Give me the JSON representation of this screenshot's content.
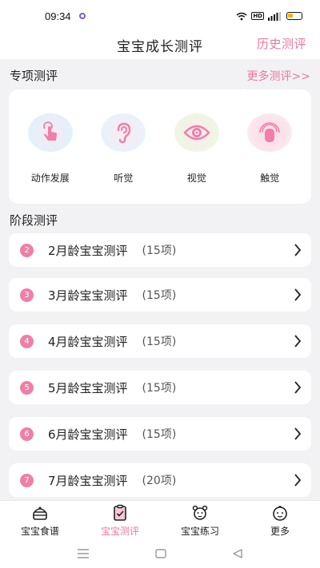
{
  "status": {
    "time": "09:34",
    "hd": "HD"
  },
  "header": {
    "title": "宝宝成长测评",
    "history": "历史测评"
  },
  "special": {
    "title": "专项测评",
    "more": "更多测评>>",
    "items": [
      {
        "label": "动作发展",
        "icon": "hand-tap-icon",
        "color": "#ee7fa8",
        "bubble": "#e2f2fa"
      },
      {
        "label": "听觉",
        "icon": "ear-icon",
        "color": "#ee7fa8",
        "bubble": "#eaf3fa"
      },
      {
        "label": "视觉",
        "icon": "eye-icon",
        "color": "#ee7fa8",
        "bubble": "#f0f7e6"
      },
      {
        "label": "触觉",
        "icon": "touch-icon",
        "color": "#ee7fa8",
        "bubble": "#fbe8ef"
      }
    ]
  },
  "stage": {
    "title": "阶段测评",
    "items": [
      {
        "num": "2",
        "name": "2月龄宝宝测评",
        "count": "(15项)"
      },
      {
        "num": "3",
        "name": "3月龄宝宝测评",
        "count": "(15项)"
      },
      {
        "num": "4",
        "name": "4月龄宝宝测评",
        "count": "(15项)"
      },
      {
        "num": "5",
        "name": "5月龄宝宝测评",
        "count": "(15项)"
      },
      {
        "num": "6",
        "name": "6月龄宝宝测评",
        "count": "(15项)"
      },
      {
        "num": "7",
        "name": "7月龄宝宝测评",
        "count": "(20项)"
      }
    ]
  },
  "tabs": [
    {
      "label": "宝宝食谱",
      "icon": "cake-icon"
    },
    {
      "label": "宝宝测评",
      "icon": "clipboard-check-icon",
      "active": true
    },
    {
      "label": "宝宝练习",
      "icon": "toy-icon"
    },
    {
      "label": "更多",
      "icon": "baby-face-icon"
    }
  ],
  "colors": {
    "accent": "#e9779f",
    "badge": "#ee7fa8"
  }
}
